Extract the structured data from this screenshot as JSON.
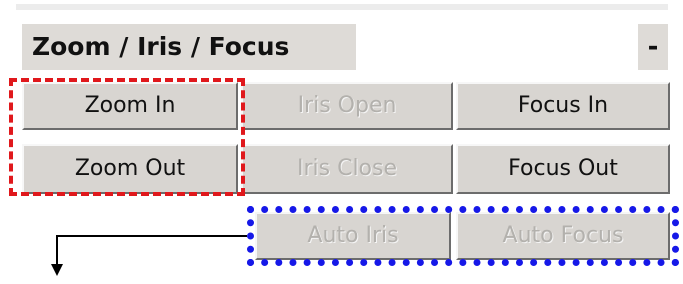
{
  "panel": {
    "title": "Zoom / Iris / Focus",
    "collapse_label": "-"
  },
  "buttons": {
    "zoom_in": "Zoom In",
    "iris_open": "Iris Open",
    "focus_in": "Focus In",
    "zoom_out": "Zoom Out",
    "iris_close": "Iris Close",
    "focus_out": "Focus Out",
    "auto_iris": "Auto Iris",
    "auto_focus": "Auto Focus"
  },
  "colors": {
    "button_face": "#d8d5d1",
    "disabled_text": "#b3b1ad",
    "highlight_red": "#e0181c",
    "highlight_blue": "#1618e8"
  },
  "icons": [
    "arrow-down-icon"
  ]
}
